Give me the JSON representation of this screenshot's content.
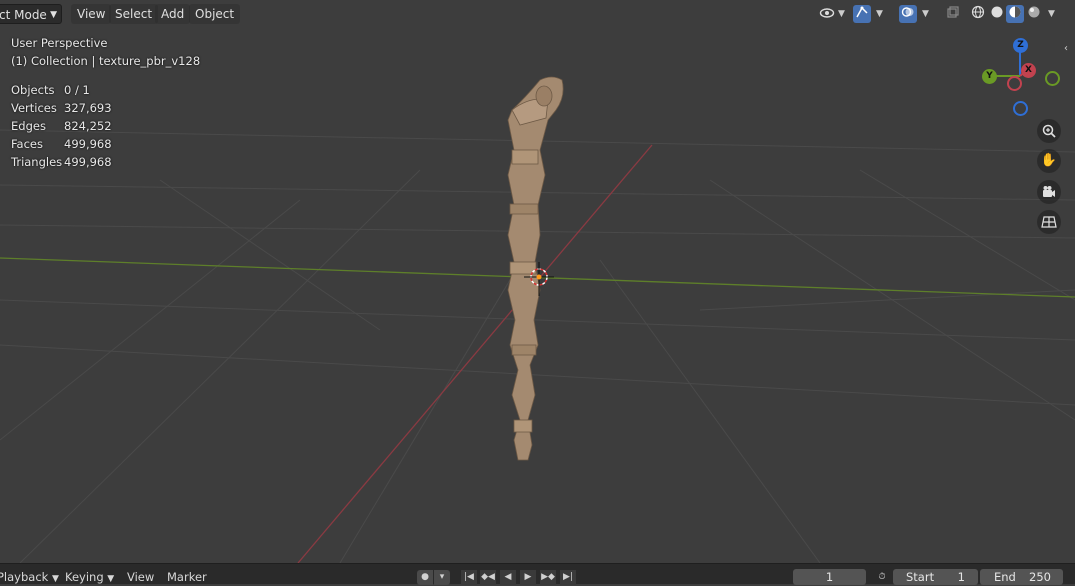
{
  "header": {
    "mode_label": "ct Mode",
    "menus": [
      "View",
      "Select",
      "Add",
      "Object"
    ]
  },
  "viewport_info": {
    "perspective": "User Perspective",
    "collection": "(1) Collection | texture_pbr_v128"
  },
  "stats": [
    {
      "label": "Objects",
      "value": "0 / 1"
    },
    {
      "label": "Vertices",
      "value": "327,693"
    },
    {
      "label": "Edges",
      "value": "824,252"
    },
    {
      "label": "Faces",
      "value": "499,968"
    },
    {
      "label": "Triangles",
      "value": "499,968"
    }
  ],
  "gizmo": {
    "z": "Z",
    "y": "Y",
    "x": "X"
  },
  "timeline": {
    "playback": "Playback",
    "keying": "Keying",
    "view": "View",
    "marker": "Marker",
    "current_frame": "1",
    "start_label": "Start",
    "start_value": "1",
    "end_label": "End",
    "end_value": "250"
  },
  "colors": {
    "x_axis": "#c2424f",
    "y_axis": "#6a9a25",
    "z_axis": "#2f6fd6",
    "viewport_bg": "#3d3d3d",
    "model": "#a48a70"
  }
}
